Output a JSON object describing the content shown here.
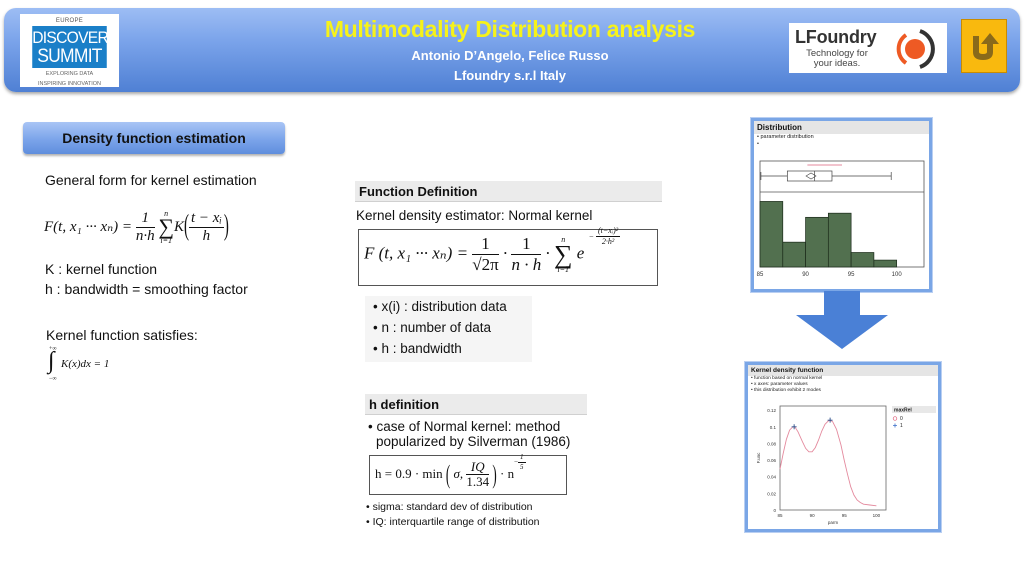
{
  "header": {
    "title": "Multimodality Distribution analysis",
    "authors": "Antonio D’Angelo, Felice Russo",
    "affiliation": "Lfoundry s.r.l Italy",
    "left_logo": {
      "top": "EUROPE",
      "line1": "DISCOVERY",
      "line2": "SUMMIT",
      "tag1": "EXPLORING DATA",
      "tag2": "INSPIRING INNOVATION"
    },
    "right_logo": {
      "name": "LFoundry",
      "tagline1": "Technology for",
      "tagline2": "your ideas."
    },
    "back_button_icon": "u-turn-up-arrow-icon"
  },
  "left": {
    "section_title": "Density function estimation",
    "general_form_label": "General form for kernel estimation",
    "formula": {
      "lhs": "F(t, x₁ ··· xₙ) =",
      "frac_num": "1",
      "frac_den": "n·h",
      "sum_top": "n",
      "sum_bottom": "i=1",
      "kernel": "K",
      "arg_num": "t − xᵢ",
      "arg_den": "h"
    },
    "def_k": "K : kernel function",
    "def_h": "h : bandwidth = smoothing factor",
    "satisfies_label": "Kernel function satisfies:",
    "integral": {
      "upper": "+∞",
      "lower": "−∞",
      "body": "K(x)dx = 1"
    }
  },
  "function_definition": {
    "header": "Function Definition",
    "subtitle": "Kernel density estimator: Normal kernel",
    "formula": {
      "lhs": "F (t, x₁ ··· xₙ) =",
      "f1_num": "1",
      "f1_den": "√2π",
      "f2_num": "1",
      "f2_den": "n · h",
      "sum_top": "n",
      "sum_bottom": "i=1",
      "base": "e",
      "exp_num": "(t−xᵢ)²",
      "exp_den": "2·h²"
    },
    "variables": [
      "x(i) : distribution data",
      "n : number of data",
      "h : bandwidth"
    ]
  },
  "h_definition": {
    "header": "h definition",
    "bullet": "case of Normal kernel: method popularized by Silverman (1986)",
    "bullet_line1": "case of Normal kernel: method",
    "bullet_line2": "popularized by Silverman (1986)",
    "formula": {
      "lhs": "h = 0.9 · min",
      "sigma": "σ,",
      "frac_num": "IQ",
      "frac_den": "1.34",
      "tail": "· n",
      "exp_num": "1",
      "exp_den": "5"
    },
    "notes": [
      "sigma: standard dev of distribution",
      "IQ: interquartile range of distribution"
    ]
  },
  "distribution_window": {
    "title": "Distribution",
    "line1": "parameter distribution",
    "line2": ""
  },
  "kernel_window": {
    "title": "Kernel density function",
    "lines": [
      "function based on normal kernel",
      "x axes: parameter values",
      "this distribution exhibit 2 modes"
    ]
  },
  "chart_data": [
    {
      "type": "bar",
      "title": "Distribution",
      "subtitle": "parameter distribution",
      "categories": [
        "85-87.5",
        "87.5-90",
        "90-92.5",
        "92.5-95",
        "95-97.5",
        "97.5-100"
      ],
      "bin_edges": [
        85,
        87.5,
        90,
        92.5,
        95,
        97.5,
        100
      ],
      "values": [
        0.95,
        0.36,
        0.72,
        0.78,
        0.21,
        0.1
      ],
      "value_units": "relative frequency (fraction of tallest bin height, estimated)",
      "xlim": [
        85,
        103
      ],
      "xticks": [
        "85",
        "90",
        "95",
        "100"
      ],
      "bar_color": "#52704f",
      "boxplot": {
        "min": 85.1,
        "q1": 88.0,
        "median": 91.0,
        "mean": 90.6,
        "q3": 92.9,
        "max": 99.4,
        "shortest_half": [
          90.2,
          94.0
        ]
      }
    },
    {
      "type": "line",
      "title": "Kernel density function",
      "xlabel": "parm",
      "ylabel": "F.unc",
      "xlim": [
        85,
        101.5
      ],
      "ylim": [
        0,
        0.125
      ],
      "xticks": [
        "85",
        "90",
        "95",
        "100"
      ],
      "yticks": [
        "0",
        "0.02",
        "0.04",
        "0.06",
        "0.08",
        "0.1",
        "0.12"
      ],
      "grid": false,
      "legend": {
        "title": "maxRel",
        "position": "right",
        "entries": [
          {
            "label": "0",
            "marker": "circle",
            "color": "#e0607a"
          },
          {
            "label": "1",
            "marker": "plus",
            "color": "#3b6fc9"
          }
        ]
      },
      "series": [
        {
          "name": "0",
          "color": "#e48a9e",
          "x": [
            85,
            85.5,
            86,
            86.5,
            87,
            87.3,
            87.8,
            88.5,
            89,
            89.5,
            90,
            90.5,
            91,
            91.5,
            92,
            92.5,
            92.8,
            93.2,
            93.8,
            94.5,
            95,
            95.5,
            96,
            96.5,
            97,
            97.5,
            98,
            99,
            100
          ],
          "y": [
            0.049,
            0.068,
            0.085,
            0.096,
            0.1,
            0.1,
            0.094,
            0.082,
            0.074,
            0.07,
            0.07,
            0.075,
            0.084,
            0.095,
            0.103,
            0.107,
            0.108,
            0.106,
            0.097,
            0.078,
            0.06,
            0.043,
            0.028,
            0.018,
            0.012,
            0.009,
            0.007,
            0.006,
            0.005
          ]
        }
      ],
      "modes": [
        {
          "x": 87.2,
          "y": 0.1
        },
        {
          "x": 92.8,
          "y": 0.108
        }
      ]
    }
  ]
}
